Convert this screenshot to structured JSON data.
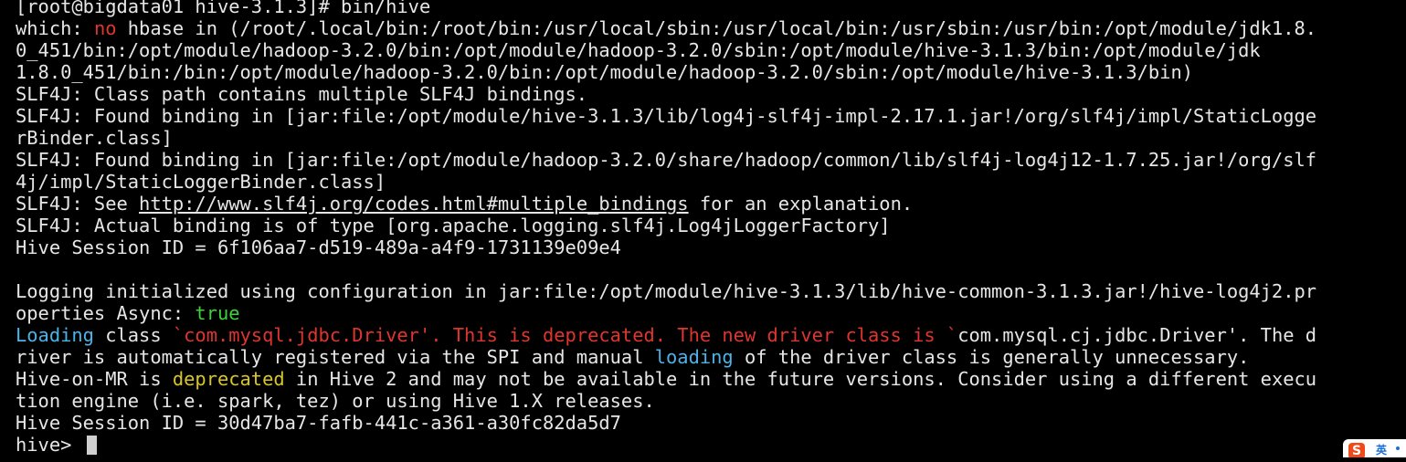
{
  "terminal": {
    "line01": "[root@bigdata01 hive-3.1.3]# bin/hive",
    "line02": {
      "a": "which: ",
      "b": "no",
      "c": " hbase in (/root/.local/bin:/root/bin:/usr/local/sbin:/usr/local/bin:/usr/sbin:/usr/bin:/opt/module/jdk1.8."
    },
    "line03": "0_451/bin:/opt/module/hadoop-3.2.0/bin:/opt/module/hadoop-3.2.0/sbin:/opt/module/hive-3.1.3/bin:/opt/module/jdk",
    "line04": "1.8.0_451/bin:/bin:/opt/module/hadoop-3.2.0/bin:/opt/module/hadoop-3.2.0/sbin:/opt/module/hive-3.1.3/bin)",
    "line05": "SLF4J: Class path contains multiple SLF4J bindings.",
    "line06": "SLF4J: Found binding in [jar:file:/opt/module/hive-3.1.3/lib/log4j-slf4j-impl-2.17.1.jar!/org/slf4j/impl/StaticLogge",
    "line07": "rBinder.class]",
    "line08": "SLF4J: Found binding in [jar:file:/opt/module/hadoop-3.2.0/share/hadoop/common/lib/slf4j-log4j12-1.7.25.jar!/org/slf",
    "line09": "4j/impl/StaticLoggerBinder.class]",
    "line10": {
      "a": "SLF4J: See ",
      "link": "http://www.slf4j.org/codes.html#multiple_bindings",
      "c": " for an explanation."
    },
    "line11": "SLF4J: Actual binding is of type [org.apache.logging.slf4j.Log4jLoggerFactory]",
    "line12": "Hive Session ID = 6f106aa7-d519-489a-a4f9-1731139e09e4",
    "line14": "Logging initialized using configuration in jar:file:/opt/module/hive-3.1.3/lib/hive-common-3.1.3.jar!/hive-log4j2.pr",
    "line15": {
      "a": "operties Async: ",
      "b": "true"
    },
    "line16": {
      "a": "Loading",
      "b": " class ",
      "c": "`com.mysql.jdbc.Driver'. This is deprecated. The new driver class is `",
      "d": "com.mysql.cj.jdbc.Driver'. The d"
    },
    "line17": {
      "a": "river is automatically registered via the SPI and manual ",
      "b": "loading",
      "c": " of the driver class is generally unnecessary."
    },
    "line18": {
      "a": "Hive-on-MR is ",
      "b": "deprecated",
      "c": " in Hive 2 and may not be available in the future versions. Consider using a different execu"
    },
    "line19": "tion engine (i.e. spark, tez) or using Hive 1.X releases.",
    "line20": "Hive Session ID = 30d47ba7-fafb-441c-a361-a30fc82da5d7",
    "prompt": "hive> "
  },
  "ime": {
    "logo_letter": "S",
    "mode_label": "英"
  },
  "colors": {
    "background": "#000000",
    "text": "#e6e6e6",
    "error": "#e0352e",
    "success": "#3ecf3e",
    "keyword": "#4cb2e8",
    "warning": "#d8c52a"
  }
}
